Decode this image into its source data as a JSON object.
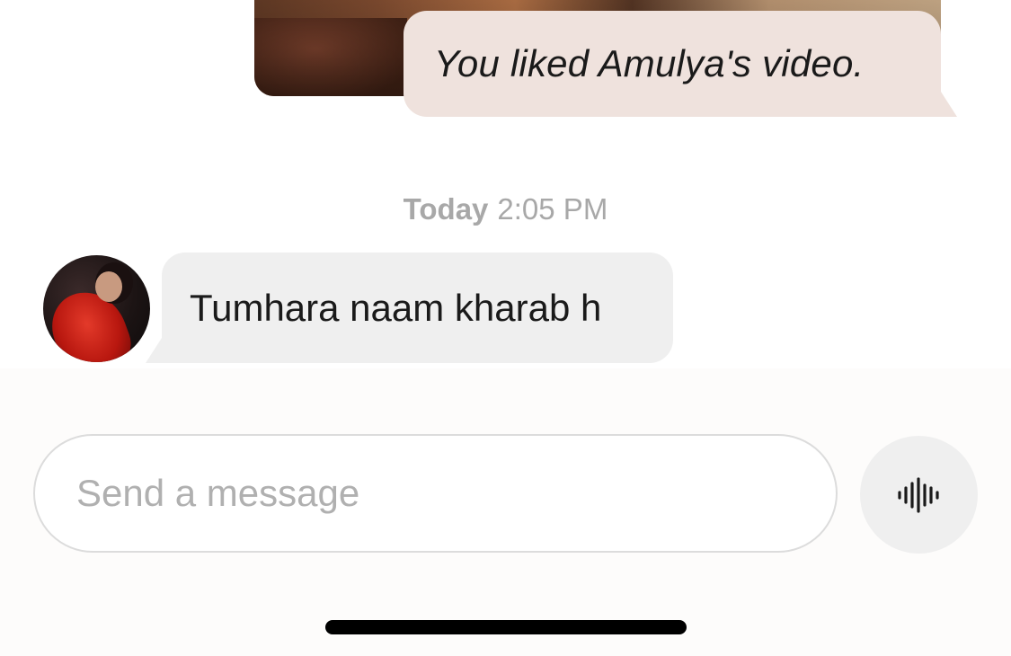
{
  "thread": {
    "shared_video": {
      "reaction_text": "You liked Amulya's video."
    },
    "divider": {
      "day": "Today",
      "time": "2:05 PM"
    },
    "messages": [
      {
        "direction": "incoming",
        "text": "Tumhara naam kharab h"
      }
    ]
  },
  "composer": {
    "placeholder": "Send a message",
    "value": "",
    "voice_icon": "waveform-icon"
  },
  "colors": {
    "reaction_bubble": "#efe2dd",
    "incoming_bubble": "#efefef",
    "timestamp_text": "#a8a8a8",
    "placeholder_text": "#b0b0b0"
  }
}
